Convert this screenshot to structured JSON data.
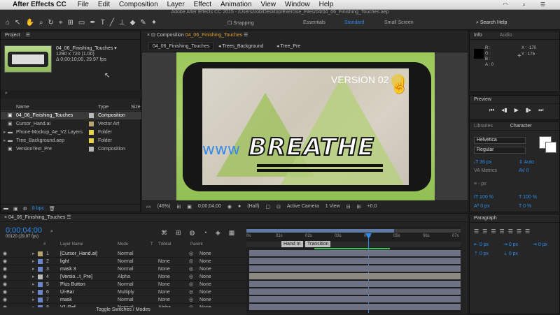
{
  "menubar": {
    "apple": "",
    "app": "After Effects CC",
    "items": [
      "File",
      "Edit",
      "Composition",
      "Layer",
      "Effect",
      "Animation",
      "View",
      "Window",
      "Help"
    ]
  },
  "toolbar": {
    "title": "Adobe After Effects CC 2015 - /Users/irob/Desktop/Exercise_Files/04/04_06_Finishing_Touches.aep",
    "snapping": "Snapping",
    "workspaces": [
      "Essentials",
      "Standard",
      "Small Screen"
    ],
    "search": "Search Help"
  },
  "project": {
    "tab": "Project",
    "item_name": "04_06_Finishing_Touches ▾",
    "item_size": "1280 x 720 (1.00)",
    "item_dur": "Δ 0;00;10;00, 29.97 fps",
    "col_name": "Name",
    "col_type": "Type",
    "col_size": "Size",
    "items": [
      {
        "name": "04_06_Finishing_Touches",
        "type": "Composition",
        "color": "#b9b9b9"
      },
      {
        "name": "Cursor_Hand.ai",
        "type": "Vector Art",
        "color": "#b8a46e"
      },
      {
        "name": "Phone-Mockup_Ae_V2 Layers",
        "type": "Folder",
        "color": "#e7d14a"
      },
      {
        "name": "Tree_Background.aep",
        "type": "Folder",
        "color": "#e7d14a"
      },
      {
        "name": "VersionText_Pre",
        "type": "Composition",
        "color": "#b9b9b9"
      }
    ],
    "bpc": "8 bpc"
  },
  "comp": {
    "tab_prefix": "Composition",
    "tab_name": "04_06_Finishing_Touches",
    "breadcrumbs": [
      "04_06_Finishing_Touches",
      "Trees_Background",
      "Tree_Pre"
    ],
    "version": "VERSION 02",
    "headline": "BREATHE",
    "url": "www",
    "zoom": "(46%)",
    "time": "0;00;04;00",
    "res": "(Half)",
    "camera": "Active Camera",
    "view": "1 View",
    "exposure": "+0.0"
  },
  "timeline": {
    "tab": "04_06_Finishing_Touches",
    "timecode": "0;00;04;00",
    "frame": "00120 (29.97 fps)",
    "cols": {
      "num": "#",
      "name": "Layer Name",
      "mode": "Mode",
      "t": "T",
      "trkmat": "TrkMat",
      "parent": "Parent"
    },
    "layers": [
      {
        "n": "1",
        "name": "[Cursor_Hand.ai]",
        "mode": "Normal",
        "trk": "",
        "parent": "None",
        "color": "#b8a46e"
      },
      {
        "n": "2",
        "name": "light",
        "mode": "Normal",
        "trk": "None",
        "parent": "None",
        "color": "#6b87c9"
      },
      {
        "n": "3",
        "name": "mask 3",
        "mode": "Normal",
        "trk": "None",
        "parent": "None",
        "color": "#6b87c9"
      },
      {
        "n": "4",
        "name": "[Versio...t_Pre]",
        "mode": "Alpha",
        "trk": "None",
        "parent": "None",
        "color": "#b9b9b9"
      },
      {
        "n": "5",
        "name": "Plus Button",
        "mode": "Normal",
        "trk": "None",
        "parent": "None",
        "color": "#6b87c9"
      },
      {
        "n": "6",
        "name": "Ui-Bar",
        "mode": "Multiply",
        "trk": "None",
        "parent": "None",
        "color": "#6b87c9"
      },
      {
        "n": "7",
        "name": "mask",
        "mode": "Normal",
        "trk": "None",
        "parent": "None",
        "color": "#6b87c9"
      },
      {
        "n": "8",
        "name": "V1-Ref",
        "mode": "Normal",
        "trk": "Alpha",
        "parent": "None",
        "color": "#6b87c9"
      }
    ],
    "ruler": [
      "0s",
      "01s",
      "02s",
      "03s",
      "04s",
      "05s",
      "06s",
      "07s"
    ],
    "markers": [
      "Hand In",
      "Transition"
    ],
    "toggle": "Toggle Switches / Modes"
  },
  "info": {
    "tabs": [
      "Info",
      "Audio"
    ],
    "rgb": [
      "R :",
      "G :",
      "B :",
      "A : 0"
    ],
    "x": "X : -170",
    "y": "Y : 176"
  },
  "preview": {
    "tab": "Preview"
  },
  "character": {
    "tabs": [
      "Libraries",
      "Character"
    ],
    "font": "Helvetica",
    "style": "Regular",
    "size": "36 px",
    "leading": "Auto",
    "kerning": "Metrics",
    "tracking": "0",
    "unit": "- px",
    "vscale": "100 %",
    "hscale": "100 %",
    "baseline": "0 px",
    "tsume": "0 %"
  },
  "paragraph": {
    "tab": "Paragraph",
    "v1": "0 px",
    "v2": "0 px",
    "v3": "0 px",
    "v4": "0 px",
    "v5": "0 px"
  }
}
